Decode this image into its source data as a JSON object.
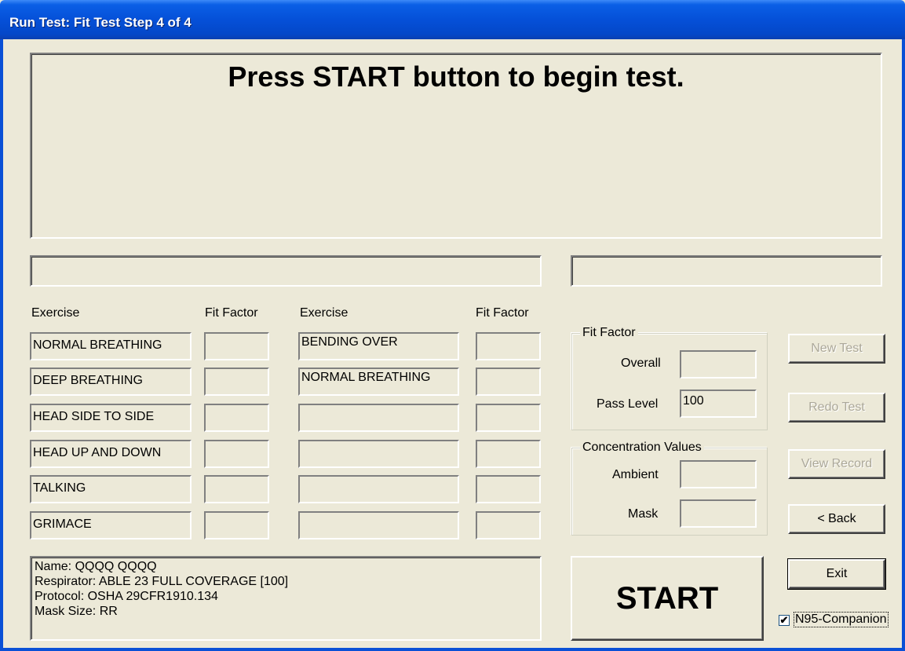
{
  "window": {
    "title": "Run Test: Fit Test Step 4 of 4"
  },
  "message": "Press START button to begin test.",
  "status": {
    "left": "",
    "right": ""
  },
  "table": {
    "headers": {
      "exercise": "Exercise",
      "fit_factor": "Fit Factor"
    },
    "left_exercises": [
      "NORMAL BREATHING",
      "DEEP BREATHING",
      "HEAD SIDE TO SIDE",
      "HEAD UP AND DOWN",
      "TALKING",
      "GRIMACE"
    ],
    "right_exercises": [
      "BENDING OVER",
      "NORMAL BREATHING",
      "",
      "",
      "",
      ""
    ],
    "left_fit_factors": [
      "",
      "",
      "",
      "",
      "",
      ""
    ],
    "right_fit_factors": [
      "",
      "",
      "",
      "",
      "",
      ""
    ]
  },
  "fit_factor_group": {
    "legend": "Fit Factor",
    "overall_label": "Overall",
    "overall_value": "",
    "pass_level_label": "Pass Level",
    "pass_level_value": "100"
  },
  "concentration_group": {
    "legend": "Concentration Values",
    "ambient_label": "Ambient",
    "ambient_value": "",
    "mask_label": "Mask",
    "mask_value": ""
  },
  "buttons": {
    "new_test": "New Test",
    "redo_test": "Redo Test",
    "view_record": "View Record",
    "back": "< Back",
    "exit": "Exit",
    "start": "START"
  },
  "info": {
    "name": "Name: QQQQ QQQQ",
    "respirator": "Respirator: ABLE 23 FULL COVERAGE [100]",
    "protocol": "Protocol: OSHA 29CFR1910.134",
    "mask_size": "Mask Size: RR"
  },
  "n95_companion": {
    "label": "N95-Companion",
    "checked": true
  }
}
